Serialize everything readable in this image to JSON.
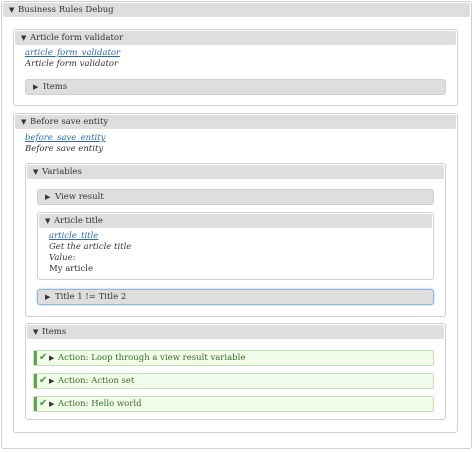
{
  "root": {
    "title": "Business Rules Debug"
  },
  "article_form": {
    "title": "Article form validator",
    "link": "article_form_validator",
    "description": "Article form validator",
    "items_label": "Items"
  },
  "before_save": {
    "title": "Before save entity",
    "link": "before_save_entity",
    "description": "Before save entity",
    "variables": {
      "title": "Variables",
      "view_result_label": "View result",
      "article_title": {
        "title": "Article title",
        "link": "article_title",
        "description": "Get the article title",
        "value_label": "Value:",
        "value": "My article"
      },
      "condition_label": "Title 1 != Title 2"
    },
    "items": {
      "title": "Items",
      "actions": [
        {
          "label": "Action: Loop through a view result variable"
        },
        {
          "label": "Action: Action set"
        },
        {
          "label": "Action: Hello world"
        }
      ]
    }
  },
  "icons": {
    "expanded": "triangle-down-icon",
    "collapsed": "triangle-right-icon",
    "success": "checkmark-icon"
  },
  "colors": {
    "link": "#2a6bb0",
    "header_bg": "#dedede",
    "success_bg": "#f0fbe9",
    "success_bar": "#5fa84a",
    "focus_border": "#8fb4de"
  }
}
